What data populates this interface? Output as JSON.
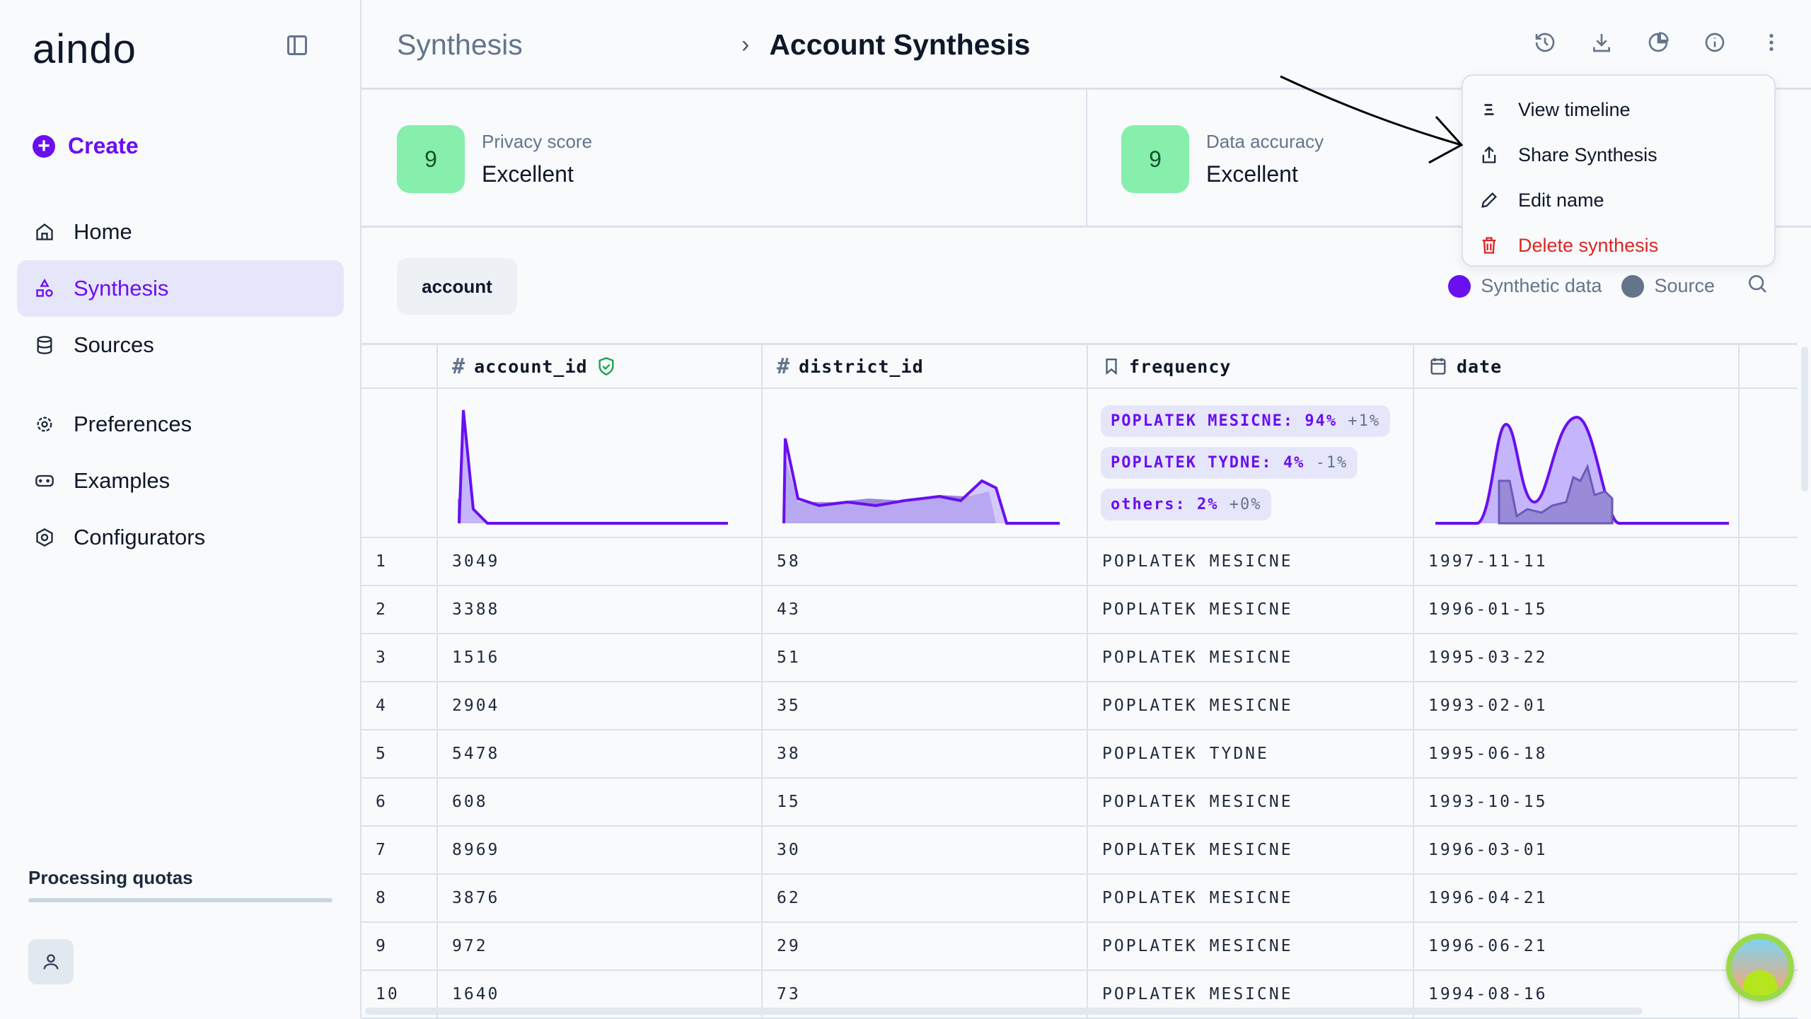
{
  "app": {
    "logo": "aindo"
  },
  "sidebar": {
    "create_label": "Create",
    "items": [
      {
        "label": "Home",
        "icon": "home-icon"
      },
      {
        "label": "Synthesis",
        "icon": "shapes-icon",
        "active": true
      },
      {
        "label": "Sources",
        "icon": "database-icon"
      },
      {
        "label": "Preferences",
        "icon": "gear-icon"
      },
      {
        "label": "Examples",
        "icon": "gamepad-icon"
      },
      {
        "label": "Configurators",
        "icon": "settings-icon"
      }
    ],
    "quota_label": "Processing quotas"
  },
  "header": {
    "breadcrumb": [
      "Synthesis",
      "Account Synthesis"
    ],
    "icons": [
      "history-icon",
      "download-icon",
      "pie-chart-icon",
      "info-icon",
      "more-vertical-icon"
    ]
  },
  "scores": [
    {
      "value": "9",
      "label": "Privacy score",
      "rating": "Excellent"
    },
    {
      "value": "9",
      "label": "Data accuracy",
      "rating": "Excellent"
    }
  ],
  "menu": {
    "items": [
      {
        "label": "View timeline",
        "icon": "timeline-icon"
      },
      {
        "label": "Share Synthesis",
        "icon": "share-icon"
      },
      {
        "label": "Edit name",
        "icon": "pencil-icon"
      },
      {
        "label": "Delete synthesis",
        "icon": "trash-icon",
        "color": "#dc2626"
      }
    ]
  },
  "tabs": [
    {
      "label": "account"
    }
  ],
  "legend": {
    "synthetic": "Synthetic data",
    "source": "Source",
    "synthetic_color": "#6a0ff0",
    "source_color": "#64748b"
  },
  "table": {
    "columns": [
      {
        "name": "account_id",
        "type_icon": "hash-icon",
        "badge": "shield-check-icon"
      },
      {
        "name": "district_id",
        "type_icon": "hash-icon"
      },
      {
        "name": "frequency",
        "type_icon": "bookmark-icon"
      },
      {
        "name": "date",
        "type_icon": "calendar-icon"
      }
    ],
    "frequency_stats": [
      {
        "label": "POPLATEK MESICNE:",
        "pct": "94%",
        "delta": "+1%"
      },
      {
        "label": "POPLATEK TYDNE:",
        "pct": "4%",
        "delta": "-1%"
      },
      {
        "label": "others:",
        "pct": "2%",
        "delta": "+0%"
      }
    ],
    "rows": [
      [
        "1",
        "3049",
        "58",
        "POPLATEK MESICNE",
        "1997-11-11"
      ],
      [
        "2",
        "3388",
        "43",
        "POPLATEK MESICNE",
        "1996-01-15"
      ],
      [
        "3",
        "1516",
        "51",
        "POPLATEK MESICNE",
        "1995-03-22"
      ],
      [
        "4",
        "2904",
        "35",
        "POPLATEK MESICNE",
        "1993-02-01"
      ],
      [
        "5",
        "5478",
        "38",
        "POPLATEK TYDNE",
        "1995-06-18"
      ],
      [
        "6",
        "608",
        "15",
        "POPLATEK MESICNE",
        "1993-10-15"
      ],
      [
        "7",
        "8969",
        "30",
        "POPLATEK MESICNE",
        "1996-03-01"
      ],
      [
        "8",
        "3876",
        "62",
        "POPLATEK MESICNE",
        "1996-04-21"
      ],
      [
        "9",
        "972",
        "29",
        "POPLATEK MESICNE",
        "1996-06-21"
      ],
      [
        "10",
        "1640",
        "73",
        "POPLATEK MESICNE",
        "1994-08-16"
      ]
    ]
  }
}
